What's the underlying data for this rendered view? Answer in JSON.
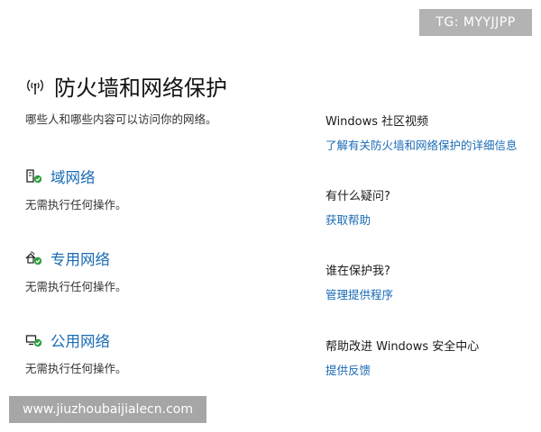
{
  "watermarks": {
    "top": "TG: MYYJJPP",
    "bottom": "www.jiuzhoubaijialecn.com"
  },
  "header": {
    "title": "防火墙和网络保护",
    "subtitle": "哪些人和哪些内容可以访问你的网络。",
    "icon": "wifi-antenna-icon"
  },
  "networks": [
    {
      "label": "域网络",
      "status": "无需执行任何操作。",
      "icon": "domain-network-icon"
    },
    {
      "label": "专用网络",
      "status": "无需执行任何操作。",
      "icon": "private-network-icon"
    },
    {
      "label": "公用网络",
      "status": "无需执行任何操作。",
      "icon": "public-network-icon"
    }
  ],
  "side": [
    {
      "heading": "Windows 社区视频",
      "link": "了解有关防火墙和网络保护的详细信息"
    },
    {
      "heading": "有什么疑问?",
      "link": "获取帮助"
    },
    {
      "heading": "谁在保护我?",
      "link": "管理提供程序"
    },
    {
      "heading": "帮助改进 Windows 安全中心",
      "link": "提供反馈"
    }
  ],
  "colors": {
    "link": "#1a6bb5",
    "check": "#2e9e3e",
    "watermark_bg": "#b3b3b3"
  }
}
